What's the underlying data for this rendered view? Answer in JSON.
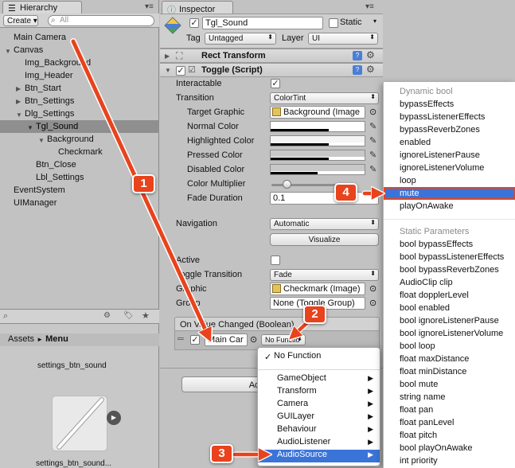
{
  "hierarchy": {
    "tab": "Hierarchy",
    "create_label": "Create ▾",
    "search_placeholder": "All",
    "items": [
      {
        "label": "Main Camera"
      },
      {
        "label": "Canvas"
      },
      {
        "label": "Img_Background"
      },
      {
        "label": "Img_Header"
      },
      {
        "label": "Btn_Start"
      },
      {
        "label": "Btn_Settings"
      },
      {
        "label": "Dlg_Settings"
      },
      {
        "label": "Tgl_Sound"
      },
      {
        "label": "Background"
      },
      {
        "label": "Checkmark"
      },
      {
        "label": "Btn_Close"
      },
      {
        "label": "Lbl_Settings"
      },
      {
        "label": "EventSystem"
      },
      {
        "label": "UIManager"
      }
    ]
  },
  "project": {
    "breadcrumb_root": "Assets",
    "breadcrumb_sep": "►",
    "breadcrumb_current": "Menu",
    "asset_top": "settings_btn_sound",
    "asset_bottom": "settings_btn_sound..."
  },
  "inspector": {
    "tab": "Inspector",
    "object_name": "Tgl_Sound",
    "static_label": "Static",
    "tag_label": "Tag",
    "tag_value": "Untagged",
    "layer_label": "Layer",
    "layer_value": "UI",
    "rect_transform": "Rect Transform",
    "toggle_script": "Toggle (Script)",
    "interactable": "Interactable",
    "transition": "Transition",
    "transition_value": "ColorTint",
    "target_graphic": "Target Graphic",
    "target_graphic_value": "Background (Image",
    "normal_color": "Normal Color",
    "highlighted_color": "Highlighted Color",
    "pressed_color": "Pressed Color",
    "disabled_color": "Disabled Color",
    "color_multiplier": "Color Multiplier",
    "fade_duration": "Fade Duration",
    "fade_duration_value": "0.1",
    "navigation": "Navigation",
    "navigation_value": "Automatic",
    "visualize": "Visualize",
    "is_on": "Active",
    "toggle_transition": "Toggle Transition",
    "toggle_transition_value": "Fade",
    "graphic": "Graphic",
    "graphic_value": "Checkmark (Image)",
    "group": "Group",
    "group_value": "None (Toggle Group)",
    "event_header": "On Value Changed (Boolean)",
    "event_object": "Main Car",
    "event_function": "No Functio",
    "add_component": "Add C"
  },
  "function_menu": {
    "no_function": "No Function",
    "check": "✓",
    "items": [
      "GameObject",
      "Transform",
      "Camera",
      "GUILayer",
      "Behaviour",
      "AudioListener",
      "AudioSource"
    ]
  },
  "audio_menu": {
    "dynamic_header": "Dynamic bool",
    "dynamic_items": [
      "bypassEffects",
      "bypassListenerEffects",
      "bypassReverbZones",
      "enabled",
      "ignoreListenerPause",
      "ignoreListenerVolume",
      "loop",
      "mute",
      "playOnAwake"
    ],
    "static_header": "Static Parameters",
    "static_items": [
      "bool bypassEffects",
      "bool bypassListenerEffects",
      "bool bypassReverbZones",
      "AudioClip clip",
      "float dopplerLevel",
      "bool enabled",
      "bool ignoreListenerPause",
      "bool ignoreListenerVolume",
      "bool loop",
      "float maxDistance",
      "float minDistance",
      "bool mute",
      "string name",
      "float pan",
      "float panLevel",
      "float pitch",
      "bool playOnAwake",
      "int priority"
    ]
  },
  "annotations": [
    "1",
    "2",
    "3",
    "4"
  ],
  "colors": {
    "selection": "#3b74d9",
    "badge": "#e8431d",
    "arrow": "#e8431d"
  }
}
